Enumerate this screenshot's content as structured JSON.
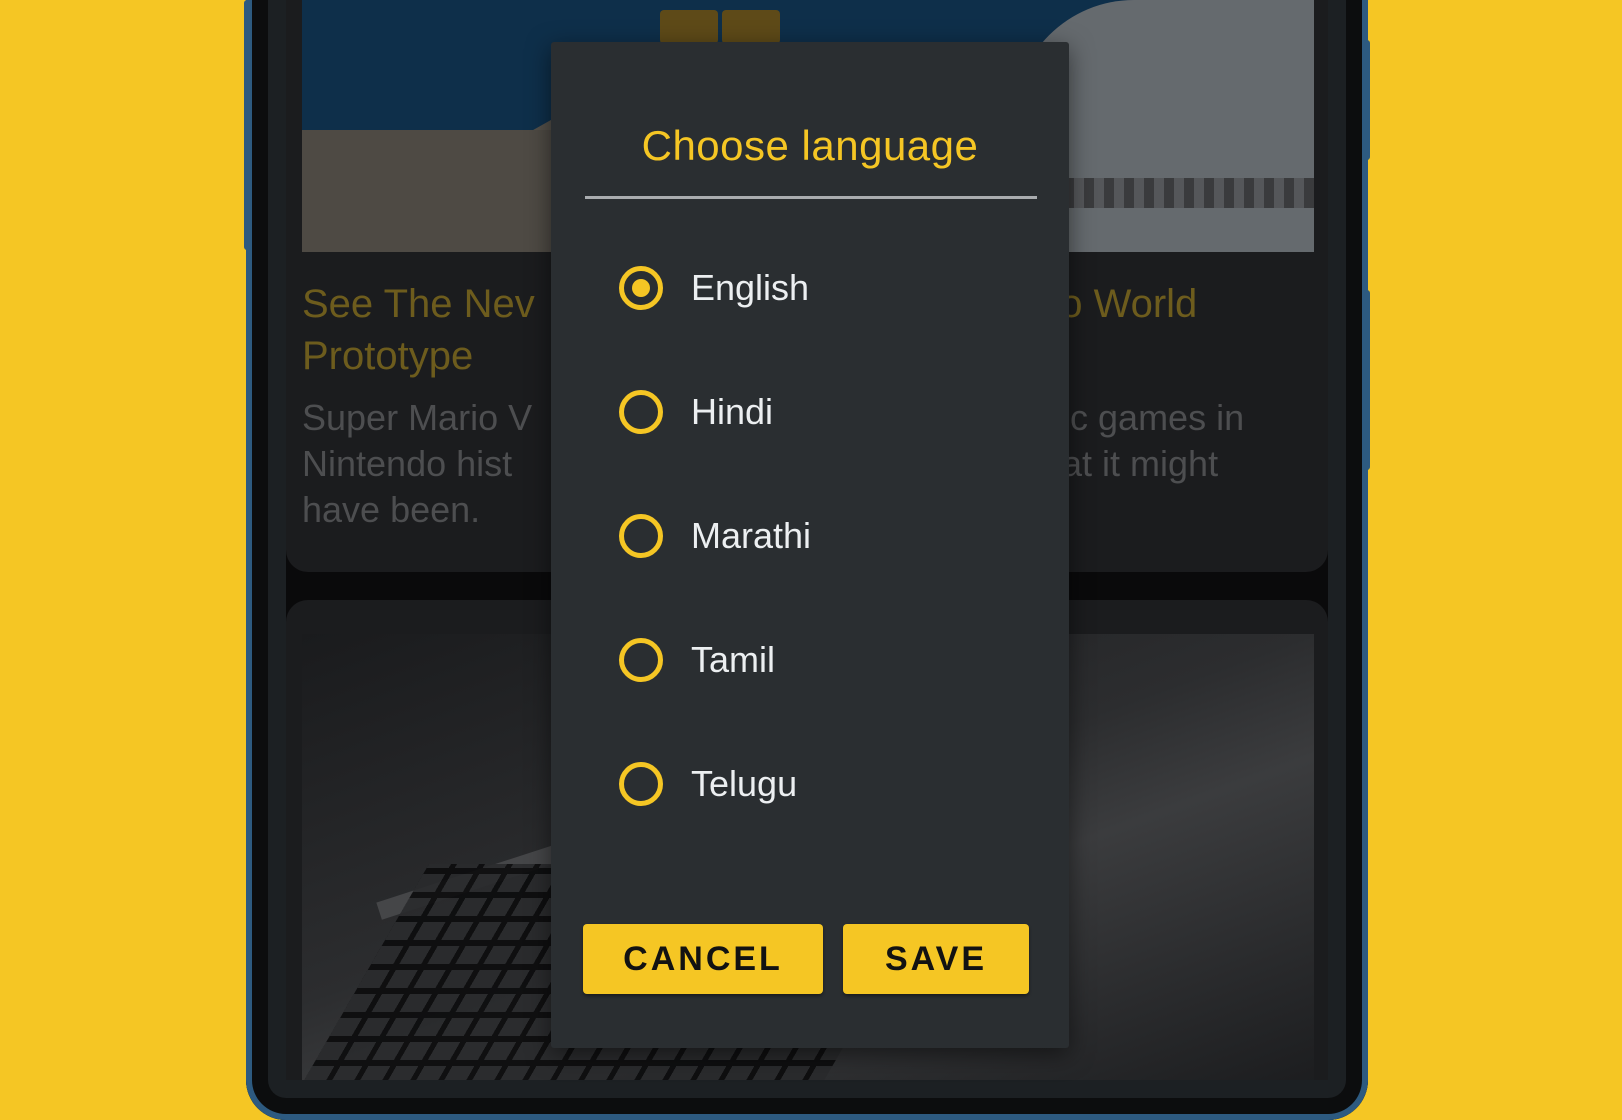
{
  "background_feed": {
    "card1": {
      "title_left_line1": "See The Nev",
      "title_left_line2": "Prototype",
      "title_right_line1": "rio World",
      "desc_left_line1": "Super Mario V",
      "desc_left_line2": "Nintendo hist",
      "desc_left_line3": "have been.",
      "desc_right_line1": "nic games in",
      "desc_right_line2": "hat it might"
    }
  },
  "dialog": {
    "title": "Choose language",
    "options": [
      {
        "label": "English",
        "selected": true
      },
      {
        "label": "Hindi",
        "selected": false
      },
      {
        "label": "Marathi",
        "selected": false
      },
      {
        "label": "Tamil",
        "selected": false
      },
      {
        "label": "Telugu",
        "selected": false
      }
    ],
    "cancel_label": "CANCEL",
    "save_label": "SAVE"
  },
  "colors": {
    "accent": "#f5c624",
    "dialog_bg": "#2a2e31",
    "text": "#eceff1",
    "page_bg": "#f5c624"
  }
}
